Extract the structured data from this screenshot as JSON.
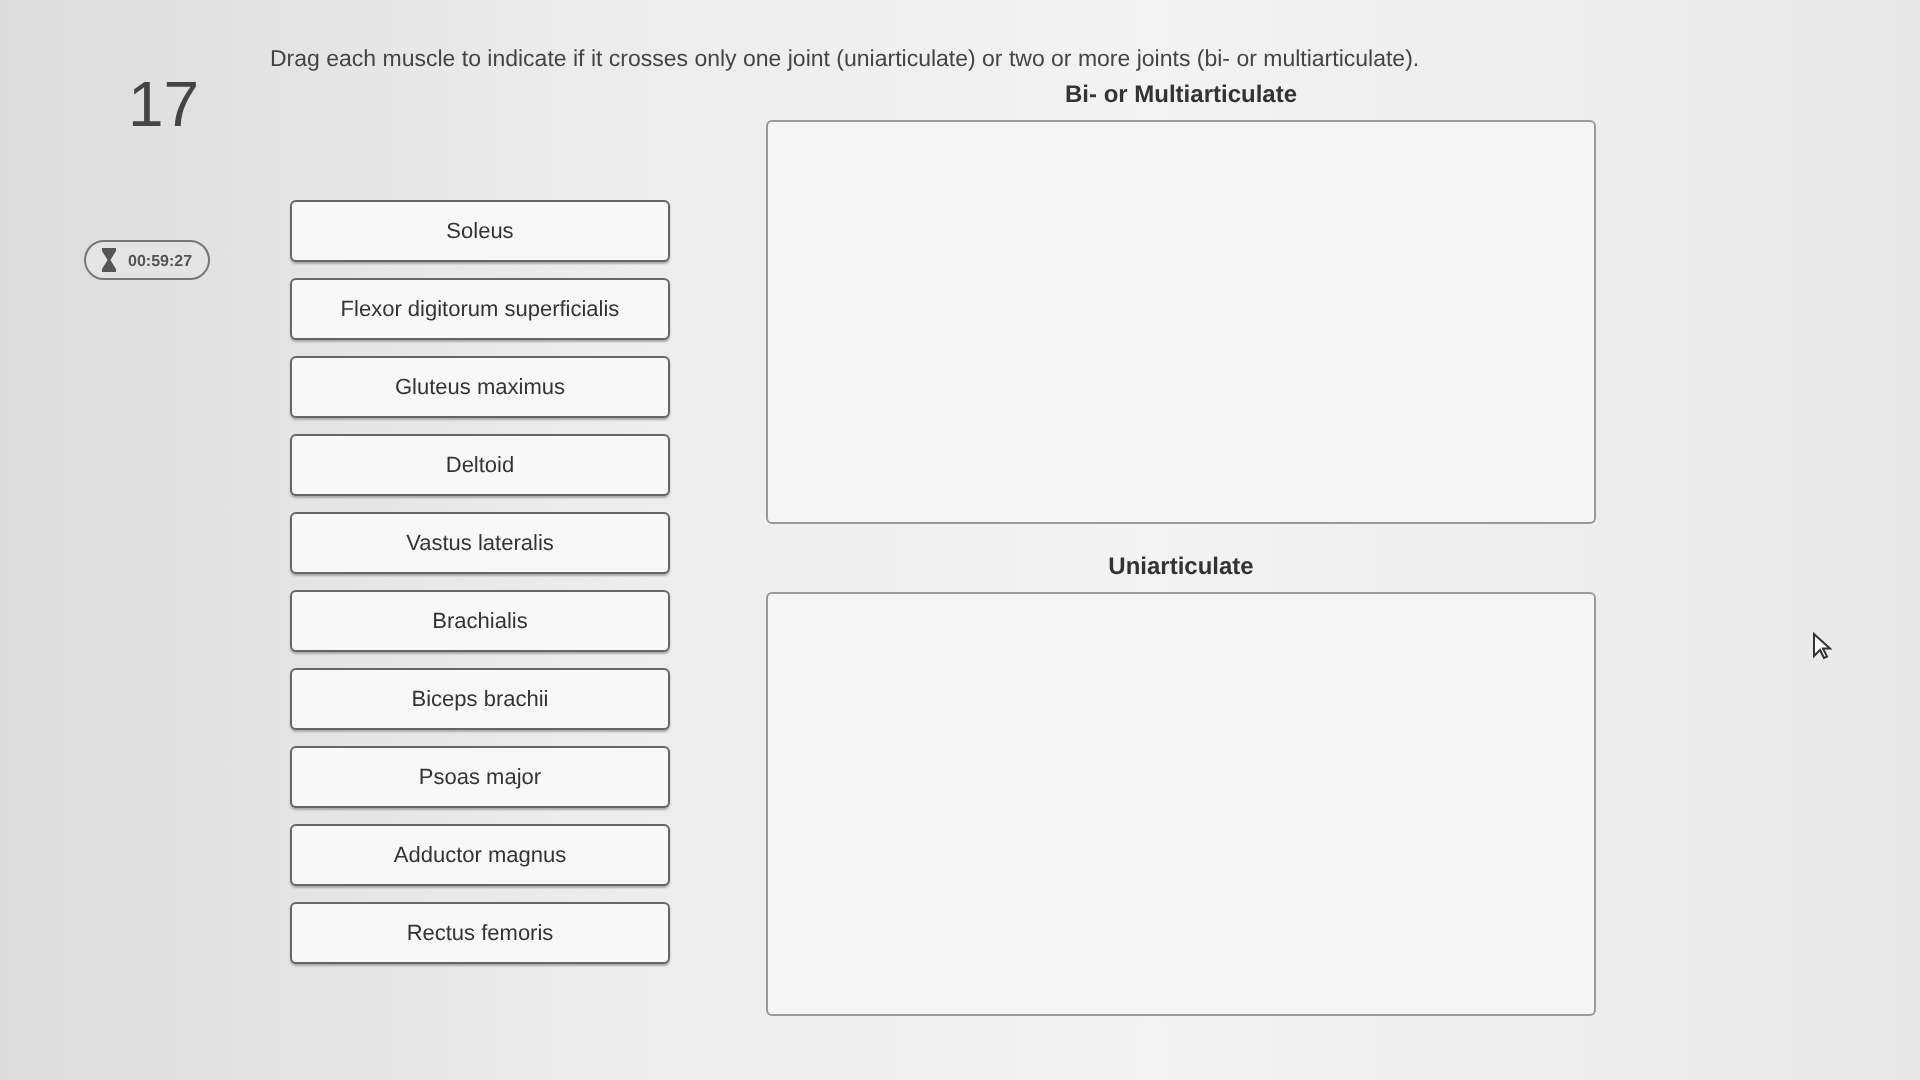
{
  "question": {
    "number": "17",
    "instruction": "Drag each muscle to indicate if it crosses only one joint (uniarticulate) or two or more joints (bi- or multiarticulate)."
  },
  "timer": {
    "time": "00:59:27"
  },
  "items": [
    "Soleus",
    "Flexor digitorum superficialis",
    "Gluteus maximus",
    "Deltoid",
    "Vastus lateralis",
    "Brachialis",
    "Biceps brachii",
    "Psoas major",
    "Adductor magnus",
    "Rectus femoris"
  ],
  "drop_zones": [
    {
      "title": "Bi- or Multiarticulate"
    },
    {
      "title": "Uniarticulate"
    }
  ]
}
